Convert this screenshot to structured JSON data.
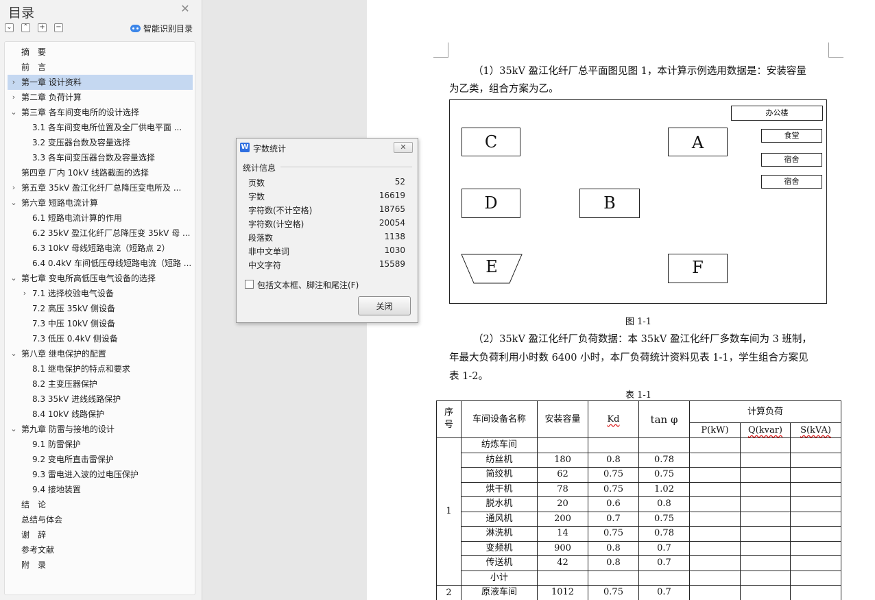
{
  "toc": {
    "title": "目录",
    "smart_label": "智能识别目录",
    "items": [
      {
        "text": "摘　要",
        "arrow": "",
        "level": 0
      },
      {
        "text": "前　言",
        "arrow": "",
        "level": 0
      },
      {
        "text": "第一章  设计资料",
        "arrow": "›",
        "level": 0,
        "selected": true
      },
      {
        "text": "第二章  负荷计算",
        "arrow": "›",
        "level": 0
      },
      {
        "text": "第三章  各车间变电所的设计选择",
        "arrow": "⌄",
        "level": 0
      },
      {
        "text": "3.1  各车间变电所位置及全厂供电平面 ...",
        "arrow": "",
        "level": 1
      },
      {
        "text": "3.2  变压器台数及容量选择",
        "arrow": "",
        "level": 1
      },
      {
        "text": "3.3  各车间变压器台数及容量选择",
        "arrow": "",
        "level": 1
      },
      {
        "text": "第四章  厂内 10kV 线路截面的选择",
        "arrow": "",
        "level": 0
      },
      {
        "text": "第五章  35kV 盈江化纤厂总降压变电所及 ...",
        "arrow": "›",
        "level": 0
      },
      {
        "text": "第六章  短路电流计算",
        "arrow": "⌄",
        "level": 0
      },
      {
        "text": "6.1 短路电流计算的作用",
        "arrow": "",
        "level": 1
      },
      {
        "text": "6.2 35kV 盈江化纤厂总降压变 35kV 母 ...",
        "arrow": "",
        "level": 1
      },
      {
        "text": "6.3 10kV 母线短路电流（短路点 2）",
        "arrow": "",
        "level": 1
      },
      {
        "text": "6.4 0.4kV 车间低压母线短路电流（短路 ...",
        "arrow": "",
        "level": 1
      },
      {
        "text": "第七章  变电所高低压电气设备的选择",
        "arrow": "⌄",
        "level": 0
      },
      {
        "text": "7.1 选择校验电气设备",
        "arrow": "›",
        "level": 1
      },
      {
        "text": "7.2  高压 35kV 侧设备",
        "arrow": "",
        "level": 1
      },
      {
        "text": "7.3  中压 10kV 侧设备",
        "arrow": "",
        "level": 1
      },
      {
        "text": "7.3  低压 0.4kV 侧设备",
        "arrow": "",
        "level": 1
      },
      {
        "text": "第八章  继电保护的配置",
        "arrow": "⌄",
        "level": 0
      },
      {
        "text": "8.1 继电保护的特点和要求",
        "arrow": "",
        "level": 1
      },
      {
        "text": "8.2 主变压器保护",
        "arrow": "",
        "level": 1
      },
      {
        "text": "8.3 35kV 进线线路保护",
        "arrow": "",
        "level": 1
      },
      {
        "text": "8.4 10kV 线路保护",
        "arrow": "",
        "level": 1
      },
      {
        "text": "第九章  防雷与接地的设计",
        "arrow": "⌄",
        "level": 0
      },
      {
        "text": "9.1  防雷保护",
        "arrow": "",
        "level": 1
      },
      {
        "text": "9.2  变电所直击雷保护",
        "arrow": "",
        "level": 1
      },
      {
        "text": "9.3  雷电进入波的过电压保护",
        "arrow": "",
        "level": 1
      },
      {
        "text": "9.4  接地装置",
        "arrow": "",
        "level": 1
      },
      {
        "text": "结　论",
        "arrow": "",
        "level": 0
      },
      {
        "text": "总结与体会",
        "arrow": "",
        "level": 0
      },
      {
        "text": "谢　辞",
        "arrow": "",
        "level": 0
      },
      {
        "text": "参考文献",
        "arrow": "",
        "level": 0
      },
      {
        "text": "附　录",
        "arrow": "",
        "level": 0
      }
    ]
  },
  "dialog": {
    "title": "字数统计",
    "section": "统计信息",
    "stats": [
      {
        "label": "页数",
        "value": "52"
      },
      {
        "label": "字数",
        "value": "16619"
      },
      {
        "label": "字符数(不计空格)",
        "value": "18765"
      },
      {
        "label": "字符数(计空格)",
        "value": "20054"
      },
      {
        "label": "段落数",
        "value": "1138"
      },
      {
        "label": "非中文单词",
        "value": "1030"
      },
      {
        "label": "中文字符",
        "value": "15589"
      }
    ],
    "checkbox_label": "包括文本框、脚注和尾注(F)",
    "close_label": "关闭"
  },
  "doc": {
    "para1_line1": "（1）35kV 盈江化纤厂总平面图见图 1，本计算示例选用数据是：安装容量",
    "para1_line2": "为乙类，组合方案为乙。",
    "plan": {
      "A": "A",
      "B": "B",
      "C": "C",
      "D": "D",
      "E": "E",
      "F": "F",
      "office": "办公楼",
      "canteen": "食堂",
      "dorm1": "宿舍",
      "dorm2": "宿舍"
    },
    "fig_caption": "图 1-1",
    "para2_line1": "（2）35kV 盈江化纤厂负荷数据：本 35kV 盈江化纤厂多数车间为 3 班制，",
    "para2_line2": "年最大负荷利用小时数 6400 小时，本厂负荷统计资料见表 1-1，学生组合方案见",
    "para2_line3": "表 1-2。",
    "table_caption": "表 1-1",
    "table": {
      "h_no": "序号",
      "h_name": "车间设备名称",
      "h_cap": "安装容量",
      "h_kd": "Kd",
      "h_tan": "tan φ",
      "h_calc": "计算负荷",
      "h_p": "P(kW)",
      "h_q": "Q(kvar)",
      "h_s": "S(kVA)",
      "group1_no": "1",
      "group2_no": "2",
      "rows": [
        {
          "name": "纺炼车间",
          "cap": "",
          "kd": "",
          "tan": ""
        },
        {
          "name": "纺丝机",
          "cap": "180",
          "kd": "0.8",
          "tan": "0.78"
        },
        {
          "name": "简绞机",
          "cap": "62",
          "kd": "0.75",
          "tan": "0.75"
        },
        {
          "name": "烘干机",
          "cap": "78",
          "kd": "0.75",
          "tan": "1.02"
        },
        {
          "name": "脱水机",
          "cap": "20",
          "kd": "0.6",
          "tan": "0.8"
        },
        {
          "name": "通风机",
          "cap": "200",
          "kd": "0.7",
          "tan": "0.75"
        },
        {
          "name": "淋洗机",
          "cap": "14",
          "kd": "0.75",
          "tan": "0.78"
        },
        {
          "name": "变频机",
          "cap": "900",
          "kd": "0.8",
          "tan": "0.7"
        },
        {
          "name": "传送机",
          "cap": "42",
          "kd": "0.8",
          "tan": "0.7"
        },
        {
          "name": "小计",
          "cap": "",
          "kd": "",
          "tan": ""
        },
        {
          "name": "原液车间",
          "cap": "1012",
          "kd": "0.75",
          "tan": "0.7"
        }
      ]
    }
  }
}
